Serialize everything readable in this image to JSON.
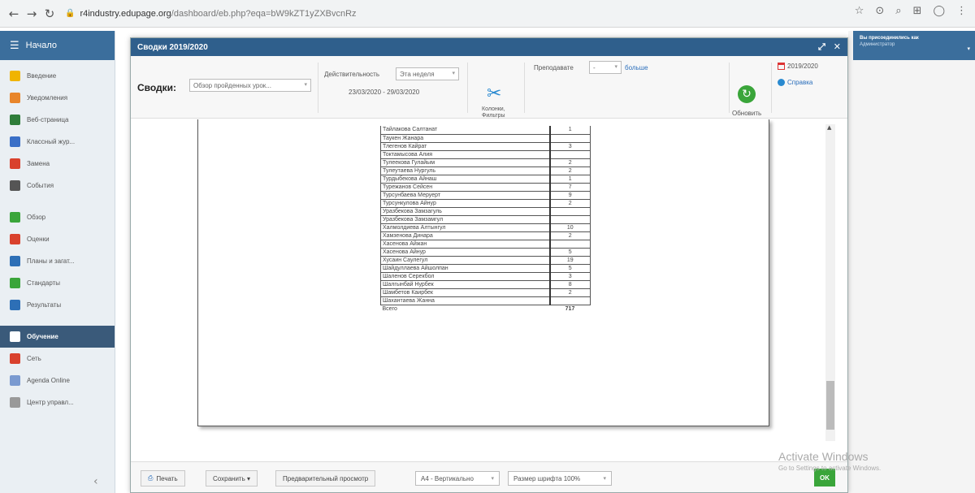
{
  "browser": {
    "url_host": "r4industry.edupage.org",
    "url_path": "/dashboard/eb.php?eqa=bW9kZT1yZXBvcnRz"
  },
  "sidebar": {
    "top_label": "Начало",
    "items": [
      {
        "label": "Введение",
        "icon": "star-icon",
        "color": "#f0b400"
      },
      {
        "label": "Уведомления",
        "icon": "bell-icon",
        "color": "#e8852a"
      },
      {
        "label": "Веб-страница",
        "icon": "home-icon",
        "color": "#2f7d3a"
      },
      {
        "label": "Классный жур...",
        "icon": "journal-icon",
        "color": "#3a6fc7"
      },
      {
        "label": "Замена",
        "icon": "substitution-icon",
        "color": "#d9412d"
      },
      {
        "label": "События",
        "icon": "calendar-icon",
        "color": "#555555"
      },
      {
        "label": "Обзор",
        "icon": "overview-icon",
        "color": "#3aa53a"
      },
      {
        "label": "Оценки",
        "icon": "grades-icon",
        "color": "#d9412d"
      },
      {
        "label": "Планы и загат...",
        "icon": "plans-icon",
        "color": "#2d6fb6"
      },
      {
        "label": "Стандарты",
        "icon": "shield-icon",
        "color": "#3aa53a"
      },
      {
        "label": "Результаты",
        "icon": "results-icon",
        "color": "#2d6fb6"
      },
      {
        "label": "Обучение",
        "icon": "learning-icon",
        "color": "#ffffff"
      },
      {
        "label": "Сеть",
        "icon": "network-icon",
        "color": "#d9412d"
      },
      {
        "label": "Agenda Online",
        "icon": "agenda-icon",
        "color": "#7a9ad0"
      },
      {
        "label": "Центр управл...",
        "icon": "gear-icon",
        "color": "#999999"
      }
    ]
  },
  "user": {
    "line1": "Вы присоединились как",
    "line2": "Администратор"
  },
  "modal": {
    "title": "Сводки 2019/2020",
    "toolbar": {
      "summaries_label": "Сводки:",
      "summary_select": "Обзор пройденных урок...",
      "activity_label": "Действительность",
      "period_select": "Эта неделя",
      "date_range": "23/03/2020 - 29/03/2020",
      "columns_label_1": "Колонки,",
      "columns_label_2": "Фильтры",
      "teacher_label": "Преподавате",
      "teacher_select": "-",
      "more_link": "больше",
      "refresh_label": "Обновить",
      "year_label": "2019/2020",
      "help_label": "Справка"
    },
    "report": {
      "rows": [
        {
          "name": "Тайлакова Салтанат",
          "value": "1"
        },
        {
          "name": "Таукен Жанара",
          "value": ""
        },
        {
          "name": "Тлегенов Кайрат",
          "value": "3"
        },
        {
          "name": "Токтамысова Алия",
          "value": ""
        },
        {
          "name": "Тулеекова Гулайым",
          "value": "2"
        },
        {
          "name": "Тулеутаева Нургуль",
          "value": "2"
        },
        {
          "name": "Турдыбекова Айнаш",
          "value": "1"
        },
        {
          "name": "Турежанов Сейсен",
          "value": "7"
        },
        {
          "name": "Турсунбаева Меруерт",
          "value": "9"
        },
        {
          "name": "Турсункулова Айнур",
          "value": "2"
        },
        {
          "name": "Уразбекова Замзагуль",
          "value": ""
        },
        {
          "name": "Уразбекова Замзамгул",
          "value": ""
        },
        {
          "name": "Халмолдиева Алтынгул",
          "value": "10"
        },
        {
          "name": "Хамзенова Динара",
          "value": "2"
        },
        {
          "name": "Хасенова Айжан",
          "value": ""
        },
        {
          "name": "Хасенова Айнур",
          "value": "5"
        },
        {
          "name": "Хусаин Саулегул",
          "value": "19"
        },
        {
          "name": "Шайдуллаева Айшолпан",
          "value": "5"
        },
        {
          "name": "Шаленов Серекбол",
          "value": "3"
        },
        {
          "name": "Шалгынбай Нурбек",
          "value": "8"
        },
        {
          "name": "Шамбетов Каирбек",
          "value": "2"
        },
        {
          "name": "Шахантаева Жанна",
          "value": ""
        }
      ],
      "total_label": "Всего",
      "total_value": "717"
    },
    "bottom": {
      "print_label": "Печать",
      "save_label": "Сохранить ▾",
      "preview_label": "Предварительный просмотр",
      "page_format": "А4 - Вертикально",
      "font_size": "Размер шрифта 100%",
      "ok_label": "OK"
    }
  },
  "watermark": {
    "line1": "Activate Windows",
    "line2": "Go to Settings to activate Windows."
  }
}
